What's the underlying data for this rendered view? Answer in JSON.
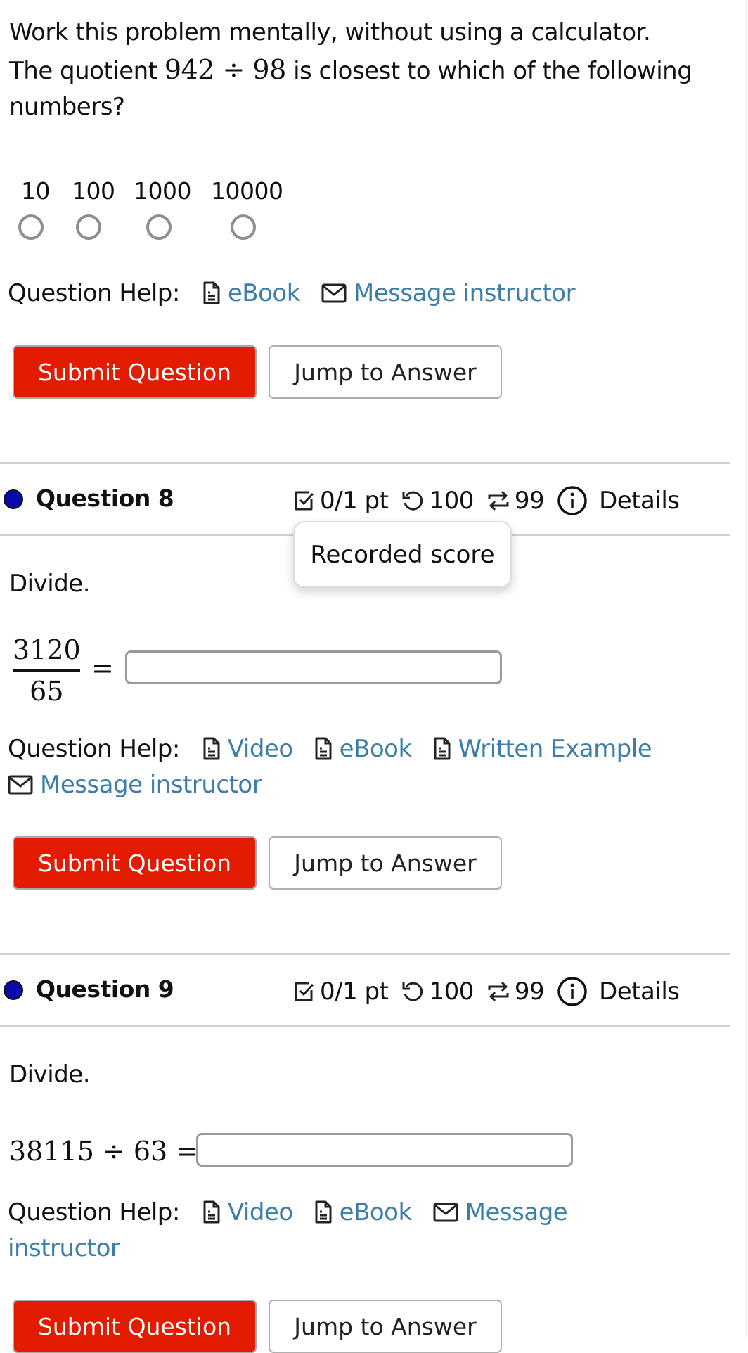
{
  "question7": {
    "prompt_line1": "Work this problem mentally, without using a calculator.",
    "prompt_line2_pre": "The quotient",
    "prompt_math": "942 ÷ 98",
    "prompt_line2_post": "is closest to which of the following",
    "prompt_line3": "numbers?",
    "options": [
      "10",
      "100",
      "1000",
      "10000"
    ],
    "help_label": "Question Help:",
    "help_links": [
      {
        "icon": "document-icon",
        "label": "eBook"
      },
      {
        "icon": "mail-icon",
        "label": "Message instructor"
      }
    ],
    "submit_label": "Submit Question",
    "jump_label": "Jump to Answer"
  },
  "question8": {
    "title": "Question 8",
    "score": "0/1 pt",
    "attempts": "100",
    "retries": "99",
    "details_label": "Details",
    "tooltip": "Recorded score",
    "instruction": "Divide.",
    "numerator": "3120",
    "denominator": "65",
    "equals": "=",
    "answer_value": "",
    "help_label": "Question Help:",
    "help_links": [
      {
        "icon": "document-icon",
        "label": "Video"
      },
      {
        "icon": "document-icon",
        "label": "eBook"
      },
      {
        "icon": "document-icon",
        "label": "Written Example"
      },
      {
        "icon": "mail-icon",
        "label": "Message instructor"
      }
    ],
    "submit_label": "Submit Question",
    "jump_label": "Jump to Answer"
  },
  "question9": {
    "title": "Question 9",
    "score": "0/1 pt",
    "attempts": "100",
    "retries": "99",
    "details_label": "Details",
    "instruction": "Divide.",
    "expression": "38115 ÷ 63 =",
    "answer_value": "",
    "help_label": "Question Help:",
    "help_links": [
      {
        "icon": "document-icon",
        "label": "Video"
      },
      {
        "icon": "document-icon",
        "label": "eBook"
      },
      {
        "icon": "mail-icon",
        "label": "Message"
      }
    ],
    "help_wrap": "instructor",
    "submit_label": "Submit Question",
    "jump_label": "Jump to Answer"
  },
  "colors": {
    "submit": "#e31b00",
    "link": "#3b7ea8",
    "status_dot": "#0a0aa8"
  }
}
